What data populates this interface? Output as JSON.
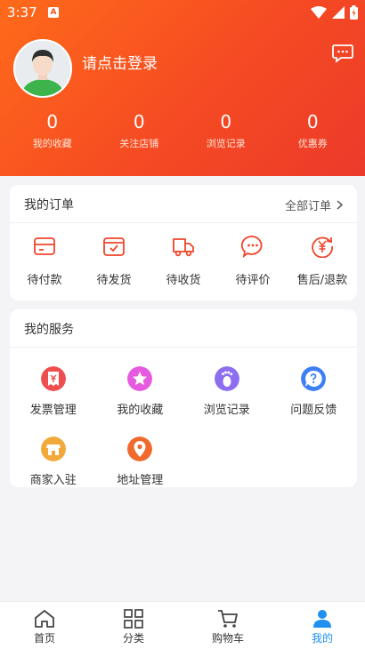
{
  "status_bar": {
    "time": "3:37",
    "app_badge": "A"
  },
  "profile": {
    "login_prompt": "请点击登录"
  },
  "stats": [
    {
      "value": "0",
      "label": "我的收藏"
    },
    {
      "value": "0",
      "label": "关注店铺"
    },
    {
      "value": "0",
      "label": "浏览记录"
    },
    {
      "value": "0",
      "label": "优惠券"
    }
  ],
  "orders": {
    "title": "我的订单",
    "all_label": "全部订单",
    "items": [
      {
        "label": "待付款",
        "icon": "wallet-icon"
      },
      {
        "label": "待发货",
        "icon": "box-check-icon"
      },
      {
        "label": "待收货",
        "icon": "truck-icon"
      },
      {
        "label": "待评价",
        "icon": "chat-bubble-icon"
      },
      {
        "label": "售后/退款",
        "icon": "refund-icon"
      }
    ]
  },
  "services": {
    "title": "我的服务",
    "items": [
      {
        "label": "发票管理",
        "icon": "invoice-icon",
        "color": "#ef4e4e"
      },
      {
        "label": "我的收藏",
        "icon": "star-icon",
        "color": "#e55adf"
      },
      {
        "label": "浏览记录",
        "icon": "footprint-icon",
        "color": "#8d6ef0"
      },
      {
        "label": "问题反馈",
        "icon": "question-icon",
        "color": "#3d7ff4"
      },
      {
        "label": "商家入驻",
        "icon": "store-icon",
        "color": "#f2a93b"
      },
      {
        "label": "地址管理",
        "icon": "location-icon",
        "color": "#f06a2e"
      }
    ]
  },
  "tabbar": [
    {
      "label": "首页",
      "icon": "home-icon",
      "active": false
    },
    {
      "label": "分类",
      "icon": "grid-icon",
      "active": false
    },
    {
      "label": "购物车",
      "icon": "cart-icon",
      "active": false
    },
    {
      "label": "我的",
      "icon": "user-icon",
      "active": true
    }
  ],
  "colors": {
    "accent": "#f0452a",
    "tab_active": "#1f8ff0",
    "hero_start": "#ff6a1a",
    "hero_end": "#ec3a2a"
  }
}
